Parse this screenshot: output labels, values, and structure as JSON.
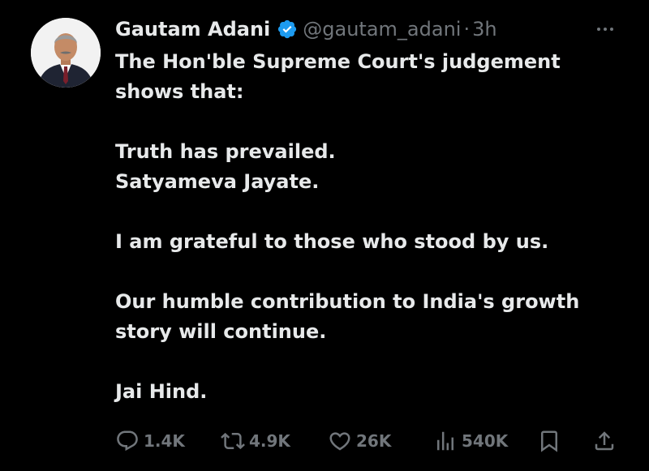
{
  "author": {
    "display_name": "Gautam Adani",
    "handle": "@gautam_adani",
    "separator": "·",
    "time": "3h",
    "verified_icon": "verified-badge-icon",
    "verified_color": "#1d9bf0"
  },
  "tweet": {
    "lines": [
      "The Hon'ble Supreme Court's judgement",
      "shows that:",
      "",
      "Truth has prevailed.",
      "Satyameva Jayate.",
      "",
      "I am grateful to those who stood by us.",
      "",
      "Our humble contribution to India's growth",
      "story will continue.",
      "",
      "Jai Hind."
    ]
  },
  "actions": {
    "reply_count": "1.4K",
    "repost_count": "4.9K",
    "like_count": "26K",
    "views_count": "540K"
  },
  "icons": {
    "more": "more-options-icon",
    "reply": "reply-icon",
    "repost": "repost-icon",
    "like": "heart-icon",
    "views": "views-icon",
    "bookmark": "bookmark-icon",
    "share": "share-icon"
  },
  "colors": {
    "background": "#000000",
    "text": "#e7e9ea",
    "muted": "#71767b"
  }
}
